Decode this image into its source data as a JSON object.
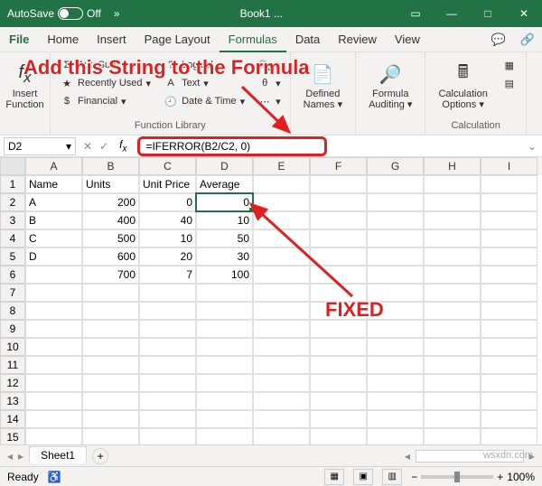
{
  "titlebar": {
    "autosave": "AutoSave",
    "off": "Off",
    "book": "Book1 ..."
  },
  "tabs": {
    "file": "File",
    "home": "Home",
    "insert": "Insert",
    "pagelayout": "Page Layout",
    "formulas": "Formulas",
    "data": "Data",
    "review": "Review",
    "view": "View"
  },
  "ribbon": {
    "insertfn": "Insert\nFunction",
    "autosum": "AutoSum",
    "recent": "Recently Used",
    "financial": "Financial",
    "logical": "Logical",
    "text": "Text",
    "datetime": "Date & Time",
    "defined": "Defined\nNames",
    "auditing": "Formula\nAuditing",
    "calcopt": "Calculation\nOptions",
    "grp_lib": "Function Library",
    "grp_calc": "Calculation"
  },
  "annotation": {
    "title": "Add this String to the Formula",
    "fixed": "FIXED"
  },
  "namebox": "D2",
  "formula": "=IFERROR(B2/C2, 0)",
  "columns": [
    "A",
    "B",
    "C",
    "D",
    "E",
    "F",
    "G",
    "H",
    "I"
  ],
  "headers": {
    "a": "Name",
    "b": "Units",
    "c": "Unit Price",
    "d": "Average"
  },
  "data": [
    {
      "a": "A",
      "b": "200",
      "c": "0",
      "d": "0"
    },
    {
      "a": "B",
      "b": "400",
      "c": "40",
      "d": "10"
    },
    {
      "a": "C",
      "b": "500",
      "c": "10",
      "d": "50"
    },
    {
      "a": "D",
      "b": "600",
      "c": "20",
      "d": "30"
    },
    {
      "a": "",
      "b": "700",
      "c": "7",
      "d": "100"
    }
  ],
  "sheet": "Sheet1",
  "status": "Ready",
  "zoom": "100%",
  "watermark": "wsxdn.com"
}
